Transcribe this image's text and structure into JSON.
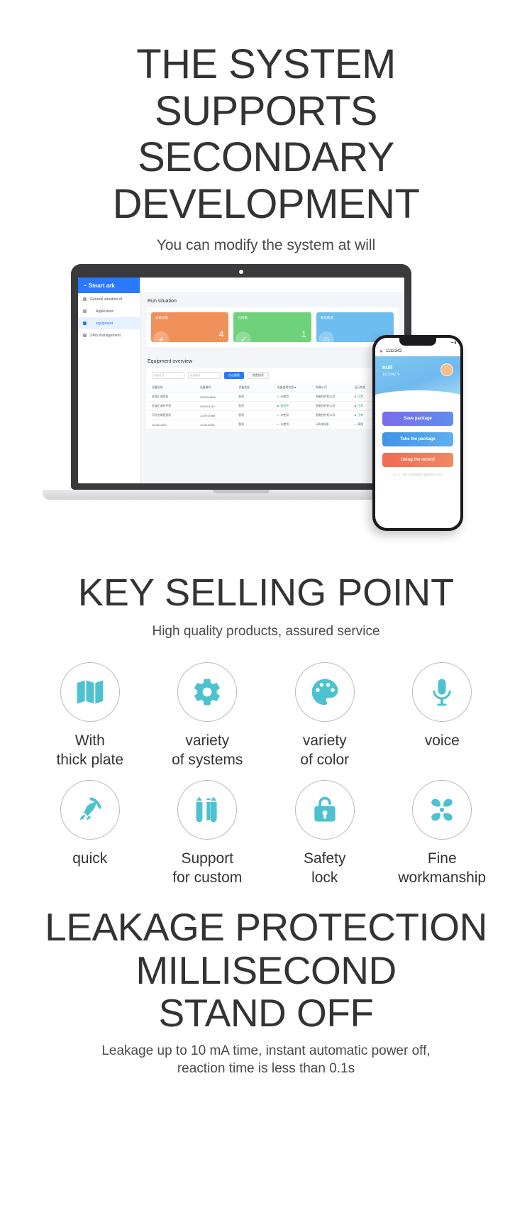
{
  "hero": {
    "title_lines": [
      "THE SYSTEM",
      "SUPPORTS",
      "SECONDARY",
      "DEVELOPMENT"
    ],
    "subtitle": "You can modify the system at will"
  },
  "laptop": {
    "brand": "Smart ark",
    "brand_glyph": "◔",
    "nav": [
      {
        "label": "General situation of",
        "active": false,
        "indent": false
      },
      {
        "label": "Application",
        "active": false,
        "indent": true
      },
      {
        "label": "equipment",
        "active": true,
        "indent": true
      },
      {
        "label": "SMS management",
        "active": false,
        "indent": false
      }
    ],
    "run_section_title": "Run situation",
    "stat_cards": [
      {
        "label": "设备总数",
        "value": "4",
        "color": "#f0915c",
        "icon": "◕"
      },
      {
        "label": "在线数",
        "value": "1",
        "color": "#6fd17a",
        "icon": "✓"
      },
      {
        "label": "离线数量",
        "value": "",
        "color": "#6ebdf0",
        "icon": "◷"
      }
    ],
    "table_section_title": "Equipment overview",
    "toolbar": {
      "input1_placeholder": "设备名称",
      "input2_placeholder": "设备编号",
      "search_label": "点击搜索",
      "reset_label": "重置搜索",
      "search_icon": "search-icon"
    },
    "table": {
      "columns": [
        "设备名称",
        "设备编号",
        "设备类型",
        "设备使用状态 ▾",
        "所属公司",
        "运行状态"
      ],
      "rows": [
        [
          "金城汇通用柜",
          "2000013698",
          "智柜",
          "未使用",
          "智能快件柜公司",
          "正常"
        ],
        [
          "金城汇通存件柜",
          "2000011187",
          "智柜",
          "使用中",
          "智能快件柜公司",
          "正常"
        ],
        [
          "河东金城智能柜",
          "1110013468",
          "智柜",
          "未使用",
          "智能快件柜公司",
          "正常"
        ],
        [
          "1114012601",
          "1114012601",
          "智柜",
          "未使用",
          "A科技有限",
          "离线"
        ]
      ]
    }
  },
  "phone": {
    "statusbar": {
      "carrier": "",
      "right": "▪▪ ▮"
    },
    "navbar": {
      "close_icon": "close-icon",
      "title": "1112342"
    },
    "hero": {
      "name": "null",
      "id": "1112342",
      "edit_icon": "pencil-icon",
      "avatar": "avatar"
    },
    "buttons": [
      {
        "label": "Save package"
      },
      {
        "label": "Take the package"
      },
      {
        "label": "Using the record"
      }
    ],
    "footer": "V1.1.0 | 交布公司版权所有 版权所有 | 00001"
  },
  "selling_point": {
    "title": "KEY SELLING POINT",
    "subtitle": "High quality products, assured service",
    "features": [
      {
        "icon": "map-icon",
        "label": "With\nthick plate"
      },
      {
        "icon": "gear-icon",
        "label": "variety\nof systems"
      },
      {
        "icon": "palette-icon",
        "label": "variety\nof color"
      },
      {
        "icon": "microphone-icon",
        "label": "voice"
      },
      {
        "icon": "rocket-icon",
        "label": "quick"
      },
      {
        "icon": "pencils-icon",
        "label": "Support\nfor custom"
      },
      {
        "icon": "lock-icon",
        "label": "Safety\nlock"
      },
      {
        "icon": "fan-icon",
        "label": "Fine\nworkmanship"
      }
    ]
  },
  "leakage": {
    "title_lines": [
      "LEAKAGE PROTECTION",
      "MILLISECOND",
      "STAND OFF"
    ],
    "subtitle_lines": [
      "Leakage up to 10 mA time, instant automatic power off,",
      "reaction time is less than 0.1s"
    ]
  },
  "colors": {
    "accent": "#4cc2cf",
    "brand_blue": "#2979ff",
    "heading": "#333333"
  }
}
